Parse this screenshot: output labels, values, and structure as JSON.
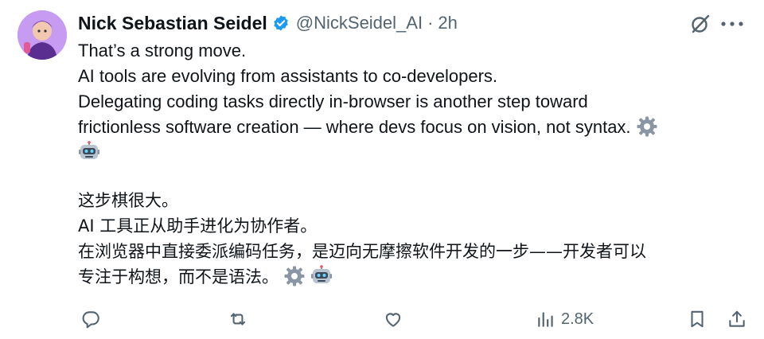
{
  "tweet": {
    "author_name": "Nick Sebastian Seidel",
    "handle": "@NickSeidel_AI",
    "separator": "·",
    "time": "2h",
    "lines_en": [
      "That’s a strong move.",
      "AI tools are evolving from assistants to co-developers.",
      "Delegating coding tasks directly in-browser is another step toward",
      "frictionless software creation — where devs focus on vision, not syntax."
    ],
    "lines_cn": [
      "这步棋很大。",
      "AI 工具正从助手进化为协作者。",
      "在浏览器中直接委派编码任务，是迈向无摩擦软件开发的一步——开发者可以",
      "专注于构想，而不是语法。"
    ]
  },
  "icons": {
    "verified": "verified-badge-icon",
    "grok": "grok-icon",
    "more": "more-icon",
    "gear_emoji": "gear-icon",
    "robot_emoji": "robot-icon",
    "reply": "reply-icon",
    "repost": "repost-icon",
    "like": "like-icon",
    "views": "views-icon",
    "bookmark": "bookmark-icon",
    "share": "share-icon"
  },
  "actions": {
    "views_count": "2.8K"
  },
  "colors": {
    "text": "#0f1419",
    "secondary": "#536471",
    "verified_blue": "#1d9bf0"
  }
}
